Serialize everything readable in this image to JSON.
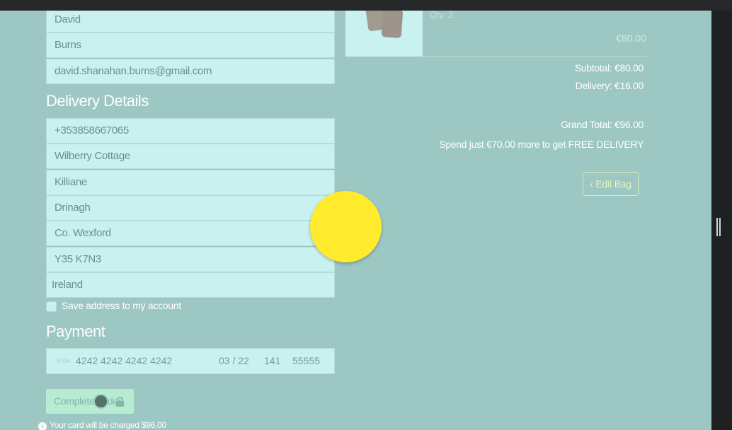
{
  "personal": {
    "first_name": "David",
    "last_name": "Burns",
    "email": "david.shanahan.burns@gmail.com"
  },
  "delivery": {
    "title": "Delivery Details",
    "phone": "+353858667065",
    "address1": "Wilberry Cottage",
    "address2": "Killiane",
    "town": "Drinagh",
    "county": "Co. Wexford",
    "postcode": "Y35 K7N3",
    "country": "Ireland",
    "save_label": "Save address to my account",
    "save_checked": false
  },
  "payment": {
    "title": "Payment",
    "brand": "VISA",
    "card_number": "4242 4242 4242 4242",
    "expiry": "03 / 22",
    "cvc": "141",
    "zip": "55555",
    "complete_label": "Complete Order",
    "charge_note": "Your card will be charged $96.00"
  },
  "order": {
    "qty": "Qty: 2",
    "line_price": "€80.00",
    "subtotal": "Subtotal: €80.00",
    "delivery": "Delivery: €16.00",
    "grand_total": "Grand Total: €96.00",
    "free_delivery_prefix": "Spend just €70.00 more to get ",
    "free_delivery_strong": "FREE DELIVERY",
    "edit_bag_label": "Edit Bag"
  },
  "colors": {
    "page_bg": "#9cc7c2",
    "field_bg": "#c8f1ef",
    "highlight": "#ffea2e",
    "edit_bag_border": "#d7f2b4"
  }
}
